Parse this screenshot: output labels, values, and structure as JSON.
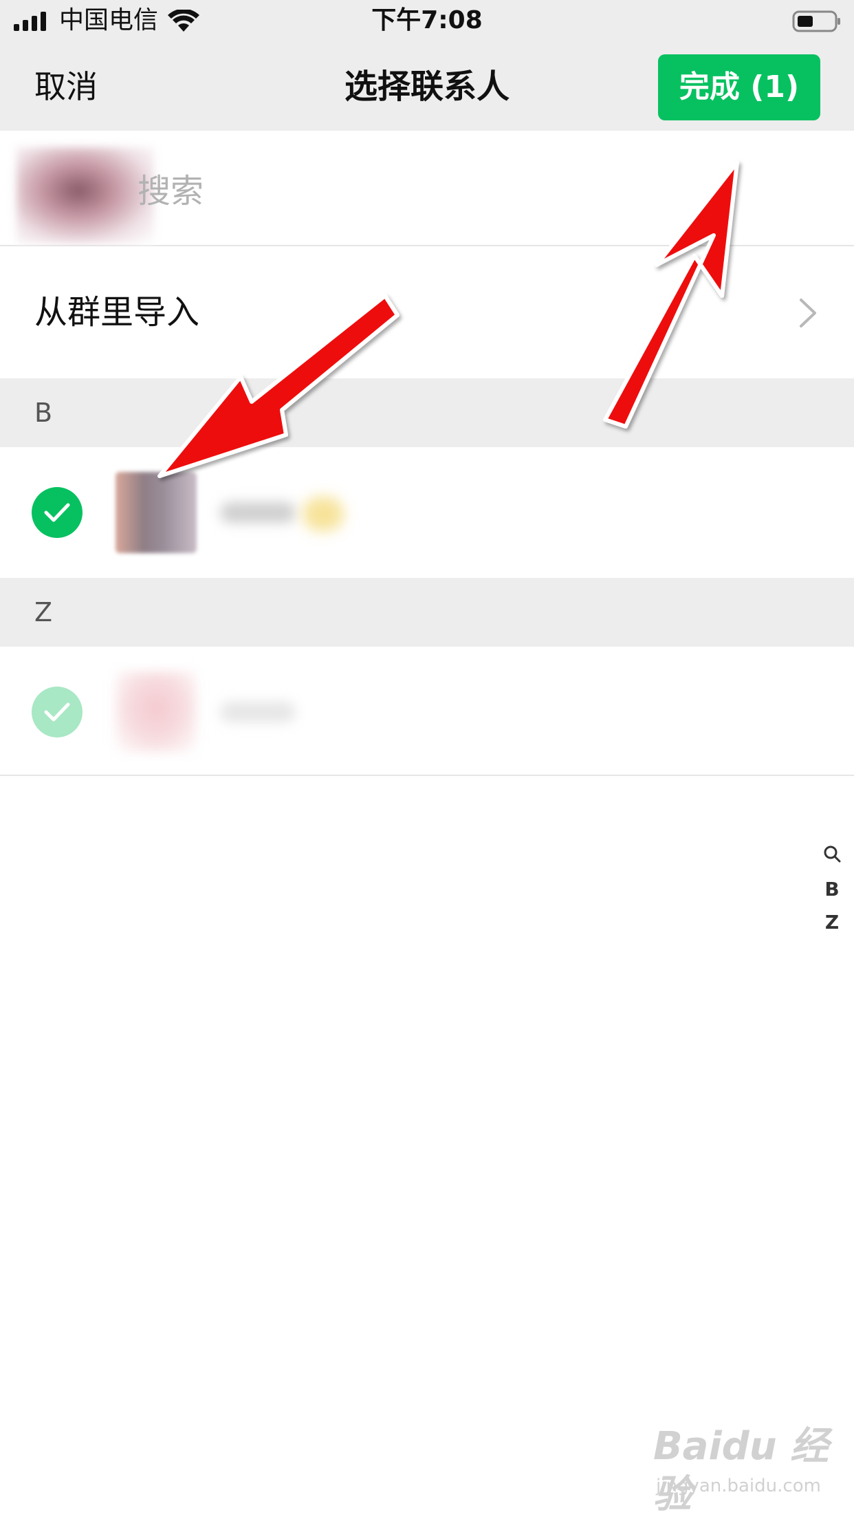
{
  "status_bar": {
    "carrier": "中国电信",
    "time": "下午7:08",
    "signal_icon": "cellular-signal-icon",
    "wifi_icon": "wifi-icon",
    "battery_icon": "battery-icon"
  },
  "nav": {
    "cancel_label": "取消",
    "title": "选择联系人",
    "done_label": "完成 (1)"
  },
  "search": {
    "placeholder_visible": "搜索"
  },
  "import_row": {
    "label": "从群里导入",
    "chevron_icon": "chevron-right-icon"
  },
  "sections": [
    {
      "letter": "B",
      "contact": {
        "selected": true
      }
    },
    {
      "letter": "Z",
      "contact": {
        "selected": true,
        "disabled": true
      }
    }
  ],
  "index_bar": {
    "items": [
      "search",
      "B",
      "Z"
    ]
  },
  "watermark": {
    "logo": "Baidu 经验",
    "sub": "jingyan.baidu.com"
  },
  "colors": {
    "accent": "#07c160",
    "nav_bg": "#ededed",
    "annotation": "#ee1111"
  }
}
